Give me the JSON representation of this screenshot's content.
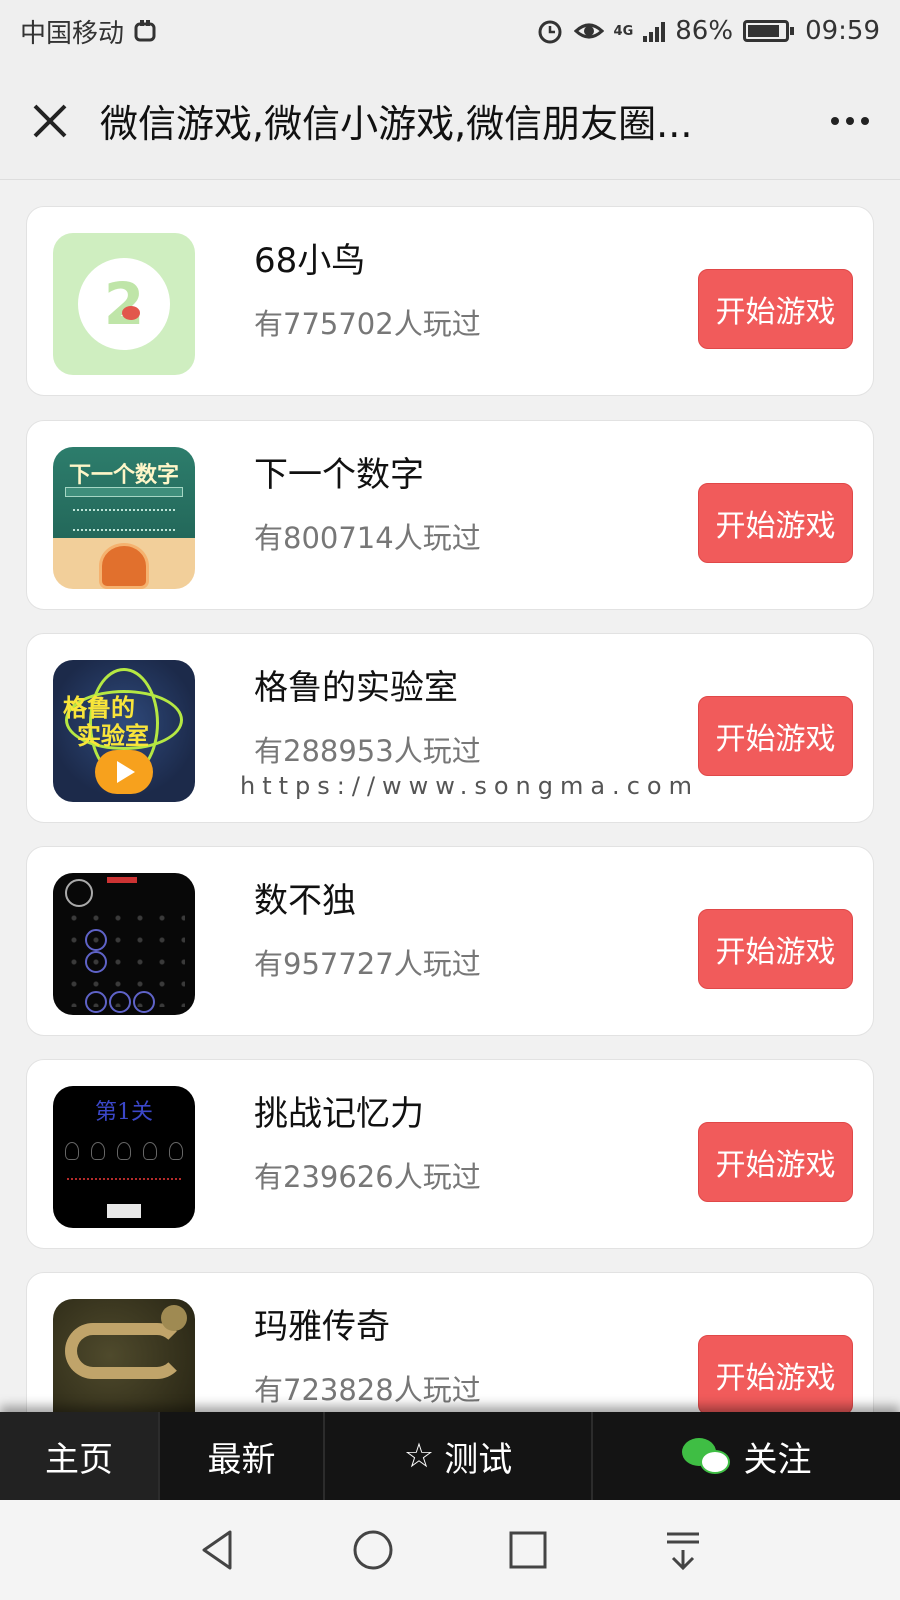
{
  "status_bar": {
    "carrier": "中国移动",
    "network": "4G",
    "battery_percent": "86%",
    "battery_level": 0.86,
    "time": "09:59"
  },
  "nav": {
    "title": "微信游戏,微信小游戏,微信朋友圈...",
    "close_icon": "close-icon",
    "more_icon": "more-icon"
  },
  "games": [
    {
      "name": "68小鸟",
      "plays": "有775702人玩过",
      "button": "开始游戏",
      "icon": "bird-game-icon"
    },
    {
      "name": "下一个数字",
      "plays": "有800714人玩过",
      "button": "开始游戏",
      "icon": "next-number-game-icon",
      "icon_text": "下一个数字"
    },
    {
      "name": "格鲁的实验室",
      "plays": "有288953人玩过",
      "button": "开始游戏",
      "icon": "lab-game-icon",
      "icon_text_1": "格鲁的",
      "icon_text_2": "实验室"
    },
    {
      "name": "数不独",
      "plays": "有957727人玩过",
      "button": "开始游戏",
      "icon": "sudoku-game-icon"
    },
    {
      "name": "挑战记忆力",
      "plays": "有239626人玩过",
      "button": "开始游戏",
      "icon": "memory-game-icon",
      "icon_text": "第1关"
    },
    {
      "name": "玛雅传奇",
      "plays": "有723828人玩过",
      "button": "开始游戏",
      "icon": "maya-game-icon"
    }
  ],
  "watermark": "https://www.songma.com",
  "bottom_menu": {
    "home": "主页",
    "latest": "最新",
    "test": "测试",
    "test_glyph": "☆",
    "follow": "关注"
  },
  "colors": {
    "start_button": "#f15b5b",
    "menu_background": "#141414",
    "wechat_green": "#3fbe44"
  }
}
